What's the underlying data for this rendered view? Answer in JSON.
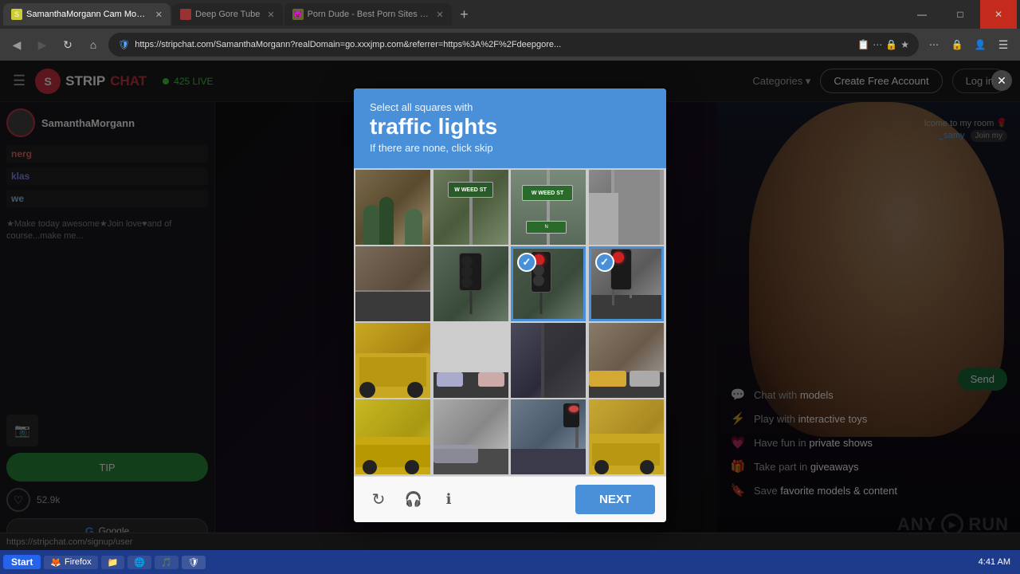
{
  "browser": {
    "tabs": [
      {
        "id": "tab1",
        "title": "SamanthaMorgann Cam Model: Fr...",
        "favicon": "🔴",
        "active": true
      },
      {
        "id": "tab2",
        "title": "Deep Gore Tube",
        "favicon": "🔴",
        "active": false
      },
      {
        "id": "tab3",
        "title": "Porn Dude - Best Porn Sites & Fre...",
        "favicon": "👿",
        "active": false
      }
    ],
    "url": "https://stripchat.com/SamanthaMorgann?realDomain=go.xxxjmp.com&referrer=https%3A%2F%2Fdeepgore...",
    "window_controls": {
      "minimize": "—",
      "maximize": "□",
      "close": "✕"
    }
  },
  "site": {
    "name": "STRIPCHAT",
    "logo_char": "S",
    "status_text": "425 LIVE",
    "model_name": "SamanthaMorgann",
    "create_account_label": "Create Free Account",
    "login_label": "Log in"
  },
  "chat": {
    "messages": [
      {
        "user": "nerg",
        "text": "nerg..."
      },
      {
        "user": "klas",
        "text": "klas..."
      },
      {
        "user": "we",
        "text": "we..."
      }
    ],
    "input_placeholder": "",
    "bottom_text": "★Make today awesome★Join love♥and of course...make me..."
  },
  "features": [
    {
      "icon": "💬",
      "text_before": "Chat with",
      "text_highlight": "models"
    },
    {
      "icon": "🎮",
      "text_before": "Play with",
      "text_highlight": "interactive toys"
    },
    {
      "icon": "❤️",
      "text_before": "Have fun in",
      "text_highlight": "private shows"
    },
    {
      "icon": "🎁",
      "text_before": "Take part in",
      "text_highlight": "giveaways"
    },
    {
      "icon": "🔖",
      "text_before": "Save",
      "text_highlight": "favorite models & content"
    }
  ],
  "captcha": {
    "header_sub": "Select all squares with",
    "header_title": "traffic lights",
    "header_hint": "If there are none, click skip",
    "next_label": "NEXT",
    "selected_cells": [
      6,
      7
    ],
    "cells": [
      {
        "id": 0,
        "type": "tree"
      },
      {
        "id": 1,
        "type": "street_sign_pole"
      },
      {
        "id": 2,
        "type": "street_sign"
      },
      {
        "id": 3,
        "type": "building_gray"
      },
      {
        "id": 4,
        "type": "street_dark"
      },
      {
        "id": 5,
        "type": "traffic_light_1"
      },
      {
        "id": 6,
        "type": "traffic_light_2",
        "selected": true
      },
      {
        "id": 7,
        "type": "street_with_light",
        "selected": true
      },
      {
        "id": 8,
        "type": "taxi_yellow"
      },
      {
        "id": 9,
        "type": "cars_street"
      },
      {
        "id": 10,
        "type": "dark_pole"
      },
      {
        "id": 11,
        "type": "cars_light"
      },
      {
        "id": 12,
        "type": "taxi_side"
      },
      {
        "id": 13,
        "type": "cars_blurry"
      },
      {
        "id": 14,
        "type": "street_traffic"
      },
      {
        "id": 15,
        "type": "taxi_yellow_2"
      }
    ],
    "footer_icons": [
      {
        "name": "reload",
        "symbol": "↻"
      },
      {
        "name": "audio",
        "symbol": "🎧"
      },
      {
        "name": "info",
        "symbol": "ℹ"
      }
    ]
  },
  "statusbar": {
    "url": "https://stripchat.com/signup/user"
  },
  "taskbar": {
    "start_label": "Start",
    "items": [
      "Firefox",
      "Chrome",
      "Folder",
      "Media"
    ],
    "time": "4:41 AM"
  },
  "likes": "52.9k"
}
